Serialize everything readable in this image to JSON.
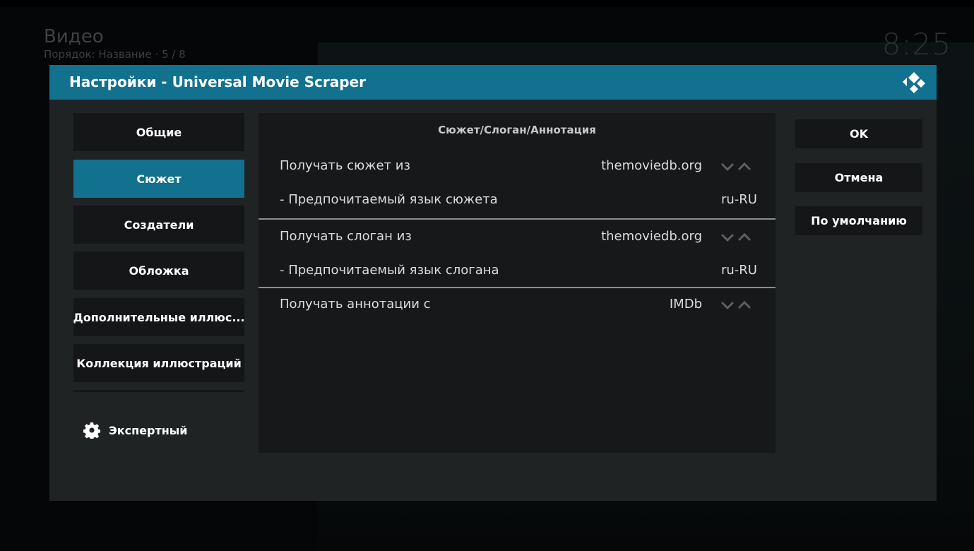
{
  "background": {
    "window_title": "Видео",
    "sort_info": "Порядок: Название · 5 / 8",
    "clock": "8:25"
  },
  "dialog": {
    "title": "Настройки - Universal Movie Scraper",
    "accent_color": "#12718f"
  },
  "categories": [
    {
      "label": "Общие",
      "active": false
    },
    {
      "label": "Сюжет",
      "active": true
    },
    {
      "label": "Создатели",
      "active": false
    },
    {
      "label": "Обложка",
      "active": false
    },
    {
      "label": "Дополнительные иллюс...",
      "active": false
    },
    {
      "label": "Коллекция иллюстраций",
      "active": false
    }
  ],
  "level_button": {
    "label": "Экспертный",
    "icon": "gear-icon"
  },
  "section": {
    "title": "Сюжет/Слоган/Аннотация",
    "settings": [
      {
        "label": "Получать сюжет из",
        "value": "themoviedb.org",
        "spinner": true
      },
      {
        "label": "- Предпочитаемый язык сюжета",
        "value": "ru-RU",
        "spinner": false
      },
      {
        "label": "Получать слоган из",
        "value": "themoviedb.org",
        "spinner": true
      },
      {
        "label": "- Предпочитаемый язык слогана",
        "value": "ru-RU",
        "spinner": false
      },
      {
        "label": "Получать аннотации с",
        "value": "IMDb",
        "spinner": true
      }
    ]
  },
  "actions": {
    "ok": "OK",
    "cancel": "Отмена",
    "defaults": "По умолчанию"
  }
}
